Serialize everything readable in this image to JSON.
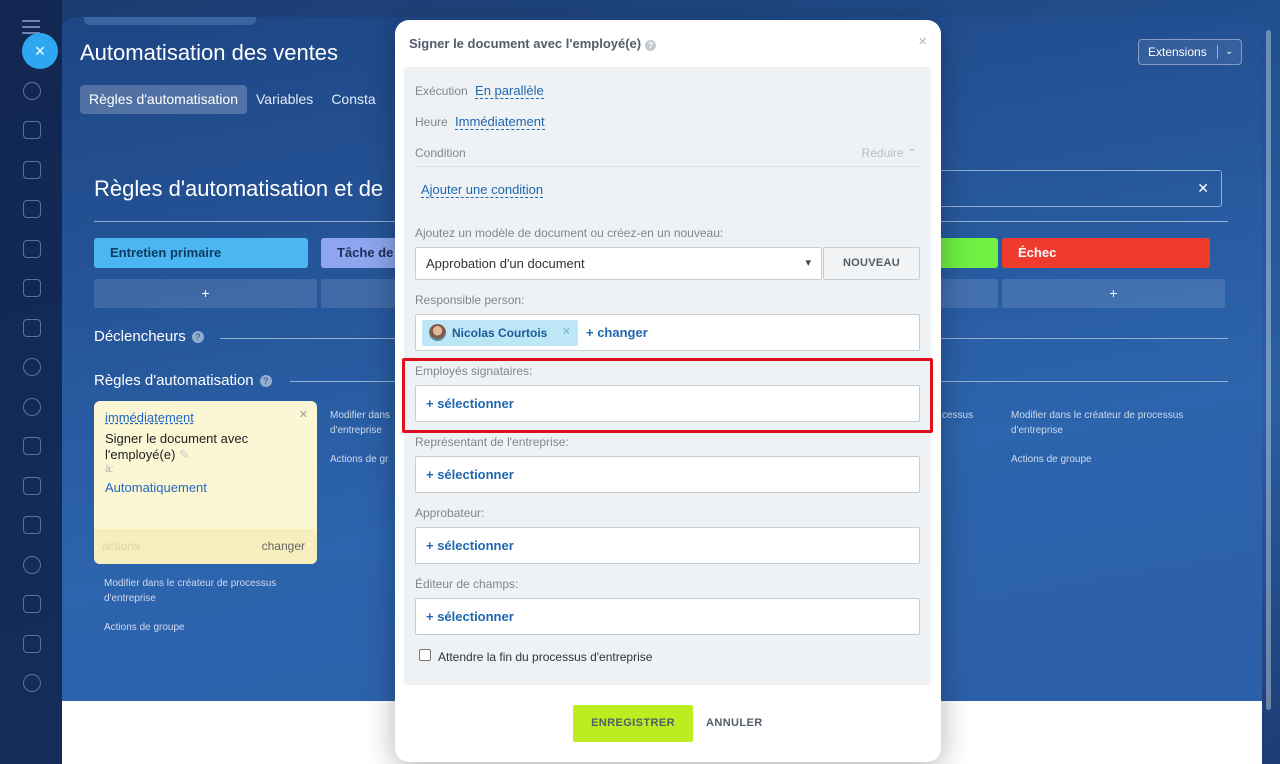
{
  "window": {
    "title": "Automatisation des ventes",
    "extensions_label": "Extensions",
    "tabs": [
      "Règles d'automatisation",
      "Variables",
      "Consta"
    ]
  },
  "main": {
    "section_title": "Règles d'automatisation et de",
    "stages": [
      {
        "label": "Entretien primaire",
        "color": "#4cb6f2"
      },
      {
        "label": "Tâche de",
        "color": "#8ea6f0"
      },
      {
        "label": "",
        "color": "#6ff043"
      },
      {
        "label": "Échec",
        "color": "#ef3a2e"
      }
    ],
    "plus": "+",
    "triggers_title": "Déclencheurs",
    "rules_title": "Règles d'automatisation",
    "rule_card": {
      "timing": "immédiatement",
      "text": "Signer le document avec l'employé(e)",
      "to_label": "à:",
      "to_value": "Automatiquement",
      "actions": "actions",
      "changer": "changer"
    },
    "links": {
      "modify": "Modifier dans le créateur de processus d'entreprise",
      "modify_short_1": "Modifier dans",
      "modify_short_2": "d'entreprise",
      "group": "Actions de groupe",
      "group_short": "Actions de gr",
      "processus_tail": "cessus"
    }
  },
  "modal": {
    "title": "Signer le document avec l'employé(e)",
    "help_icon": "?",
    "close_icon": "×",
    "execution_label": "Exécution",
    "execution_value": "En parallèle",
    "time_label": "Heure",
    "time_value": "Immédiatement",
    "condition_label": "Condition",
    "reduce_label": "Réduire",
    "add_condition": "Ajouter une condition",
    "template_label": "Ajoutez un modèle de document ou créez-en un nouveau:",
    "template_value": "Approbation d'un document",
    "new_button": "NOUVEAU",
    "responsible_label": "Responsible person:",
    "responsible_name": "Nicolas Courtois",
    "change_link": "+ changer",
    "signers_label": "Employés signataires:",
    "company_rep_label": "Représentant de l'entreprise:",
    "approver_label": "Approbateur:",
    "field_editor_label": "Éditeur de champs:",
    "select_link": "+ sélectionner",
    "wait_label": "Attendre la fin du processus d'entreprise",
    "save_button": "ENREGISTRER",
    "cancel_button": "ANNULER"
  },
  "colors": {
    "accent": "#2067b0",
    "save": "#bbed21",
    "highlight": "#e0101c"
  }
}
